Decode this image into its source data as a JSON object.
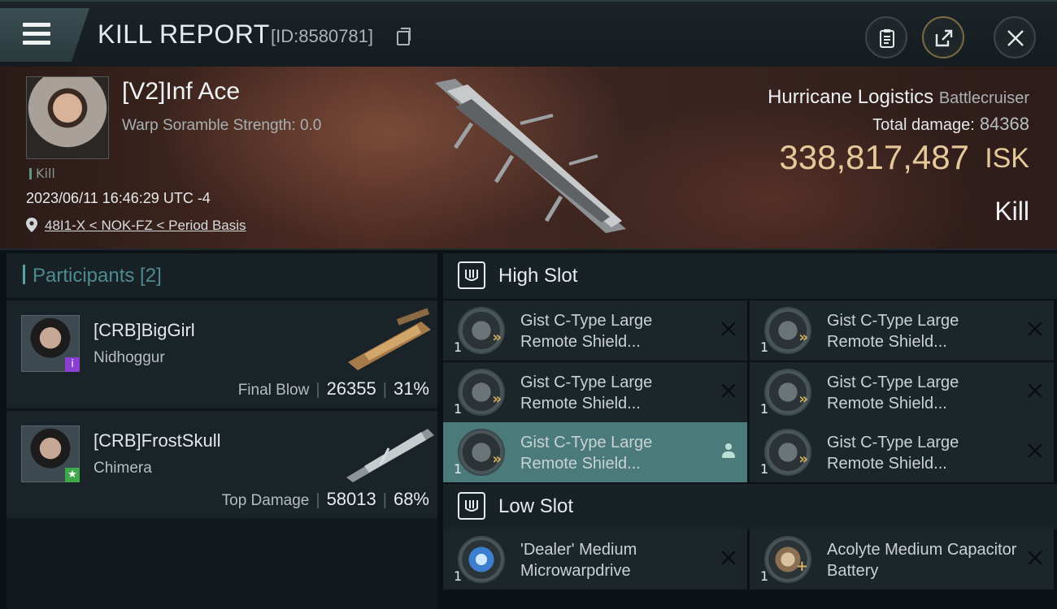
{
  "header": {
    "title": "KILL REPORT",
    "report_id": "[ID:8580781]"
  },
  "victim": {
    "name": "[V2]Inf Ace",
    "warp_scramble": "Warp Soramble Strength: 0.0",
    "kill_tag": "Kill",
    "time": "2023/06/11 16:46:29 UTC -4",
    "location": "48I1-X < NOK-FZ < Period Basis",
    "ship_name": "Hurricane Logistics",
    "ship_class": "Battlecruiser",
    "total_damage_label": "Total damage:",
    "total_damage_value": "84368",
    "isk_value": "338,817,487",
    "isk_unit": "ISK",
    "result": "Kill"
  },
  "participants": {
    "title": "Participants [2]",
    "rows": [
      {
        "name": "[CRB]BigGirl",
        "ship": "Nidhoggur",
        "stat_label": "Final Blow",
        "damage": "26355",
        "percent": "31%",
        "badge": "i",
        "badge_color": "#8a3fd1"
      },
      {
        "name": "[CRB]FrostSkull",
        "ship": "Chimera",
        "stat_label": "Top Damage",
        "damage": "58013",
        "percent": "68%",
        "badge": "★",
        "badge_color": "#3ea84b"
      }
    ]
  },
  "high_slot": {
    "title": "High Slot",
    "modules": [
      {
        "name": "Gist C-Type Large Remote Shield...",
        "qty": "1"
      },
      {
        "name": "Gist C-Type Large Remote Shield...",
        "qty": "1"
      },
      {
        "name": "Gist C-Type Large Remote Shield...",
        "qty": "1"
      },
      {
        "name": "Gist C-Type Large Remote Shield...",
        "qty": "1"
      },
      {
        "name": "Gist C-Type Large Remote Shield...",
        "qty": "1"
      },
      {
        "name": "Gist C-Type Large Remote Shield...",
        "qty": "1"
      }
    ]
  },
  "low_slot": {
    "title": "Low Slot",
    "modules": [
      {
        "name": "'Dealer' Medium Microwarpdrive",
        "qty": "1"
      },
      {
        "name": "Acolyte Medium Capacitor Battery",
        "qty": "1"
      }
    ]
  }
}
